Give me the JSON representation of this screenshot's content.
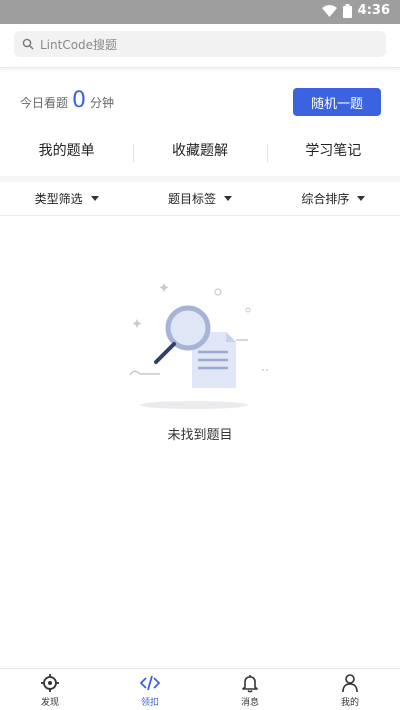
{
  "status_bar": {
    "time": "4:36"
  },
  "search": {
    "placeholder": "LintCode搜题"
  },
  "stats": {
    "prefix": "今日看题",
    "count": "0",
    "unit": "分钟"
  },
  "random_button": {
    "label": "随机一题"
  },
  "tabs": [
    {
      "label": "我的题单"
    },
    {
      "label": "收藏题解"
    },
    {
      "label": "学习笔记"
    }
  ],
  "filters": [
    {
      "label": "类型筛选"
    },
    {
      "label": "题目标签"
    },
    {
      "label": "综合排序"
    }
  ],
  "empty_state": {
    "text": "未找到题目"
  },
  "bottom_nav": [
    {
      "label": "发现",
      "icon": "target-icon",
      "active": false
    },
    {
      "label": "领扣",
      "icon": "code-icon",
      "active": true
    },
    {
      "label": "消息",
      "icon": "bell-icon",
      "active": false
    },
    {
      "label": "我的",
      "icon": "person-icon",
      "active": false
    }
  ],
  "colors": {
    "accent": "#3b63e0",
    "status_bar": "#9e9e9e",
    "search_bg": "#f2f2f2"
  }
}
